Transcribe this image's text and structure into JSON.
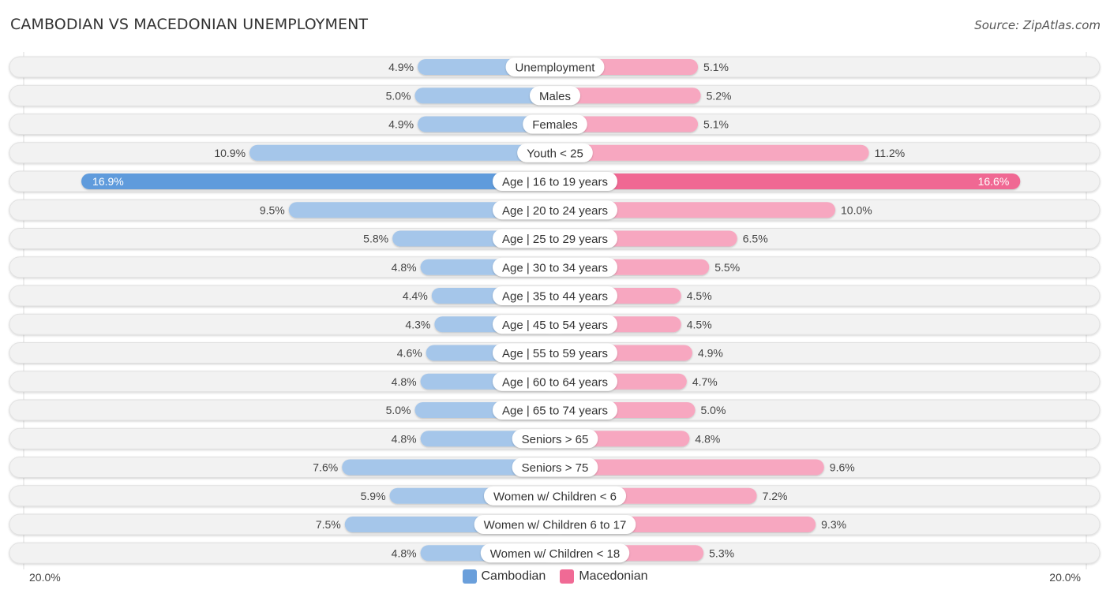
{
  "header": {
    "title": "CAMBODIAN VS MACEDONIAN UNEMPLOYMENT",
    "source": "Source: ZipAtlas.com"
  },
  "legend": {
    "items": [
      {
        "label": "Cambodian",
        "color": "#6a9fdb"
      },
      {
        "label": "Macedonian",
        "color": "#f06a95"
      }
    ]
  },
  "axis": {
    "left_label": "20.0%",
    "right_label": "20.0%"
  },
  "colors": {
    "left_normal": "#a5c6ea",
    "left_strong": "#5f9bdc",
    "right_normal": "#f7a7c0",
    "right_strong": "#f06893",
    "track": "#f2f2f2"
  },
  "chart_data": {
    "type": "bar",
    "orientation": "horizontal-diverging",
    "title": "CAMBODIAN VS MACEDONIAN UNEMPLOYMENT",
    "xlim": [
      -20,
      20
    ],
    "xlabel": "",
    "ylabel": "",
    "unit": "%",
    "legend_position": "bottom-center",
    "grid": false,
    "categories": [
      "Unemployment",
      "Males",
      "Females",
      "Youth < 25",
      "Age | 16 to 19 years",
      "Age | 20 to 24 years",
      "Age | 25 to 29 years",
      "Age | 30 to 34 years",
      "Age | 35 to 44 years",
      "Age | 45 to 54 years",
      "Age | 55 to 59 years",
      "Age | 60 to 64 years",
      "Age | 65 to 74 years",
      "Seniors > 65",
      "Seniors > 75",
      "Women w/ Children < 6",
      "Women w/ Children 6 to 17",
      "Women w/ Children < 18"
    ],
    "series": [
      {
        "name": "Cambodian",
        "side": "left",
        "values": [
          4.9,
          5.0,
          4.9,
          10.9,
          16.9,
          9.5,
          5.8,
          4.8,
          4.4,
          4.3,
          4.6,
          4.8,
          5.0,
          4.8,
          7.6,
          5.9,
          7.5,
          4.8
        ],
        "labels": [
          "4.9%",
          "5.0%",
          "4.9%",
          "10.9%",
          "16.9%",
          "9.5%",
          "5.8%",
          "4.8%",
          "4.4%",
          "4.3%",
          "4.6%",
          "4.8%",
          "5.0%",
          "4.8%",
          "7.6%",
          "5.9%",
          "7.5%",
          "4.8%"
        ]
      },
      {
        "name": "Macedonian",
        "side": "right",
        "values": [
          5.1,
          5.2,
          5.1,
          11.2,
          16.6,
          10.0,
          6.5,
          5.5,
          4.5,
          4.5,
          4.9,
          4.7,
          5.0,
          4.8,
          9.6,
          7.2,
          9.3,
          5.3
        ],
        "labels": [
          "5.1%",
          "5.2%",
          "5.1%",
          "11.2%",
          "16.6%",
          "10.0%",
          "6.5%",
          "5.5%",
          "4.5%",
          "4.5%",
          "4.9%",
          "4.7%",
          "5.0%",
          "4.8%",
          "9.6%",
          "7.2%",
          "9.3%",
          "5.3%"
        ]
      }
    ],
    "highlighted_category": "Age | 16 to 19 years"
  }
}
